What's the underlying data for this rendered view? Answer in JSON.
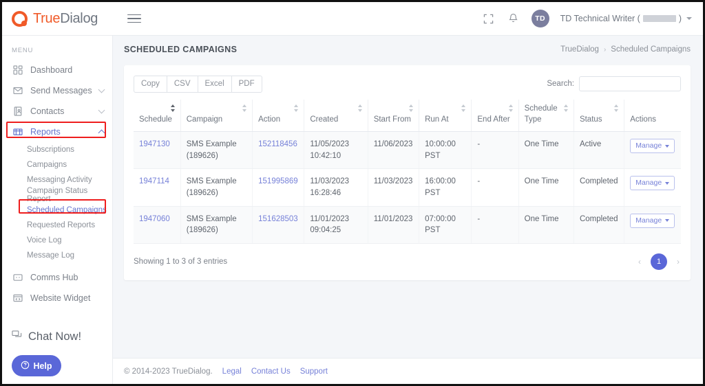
{
  "header": {
    "brand_primary": "True",
    "brand_secondary": "Dialog",
    "menu_toggle": "menu-toggle",
    "fullscreen_label": "Fullscreen",
    "notifications_label": "Notifications",
    "avatar_initials": "TD",
    "username_prefix": "TD Technical Writer (",
    "username_suffix": ")"
  },
  "sidebar": {
    "menu_label": "MENU",
    "items": [
      {
        "label": "Dashboard",
        "icon": "grid-icon",
        "expandable": false,
        "active": false
      },
      {
        "label": "Send Messages",
        "icon": "envelope-icon",
        "expandable": true,
        "active": false
      },
      {
        "label": "Contacts",
        "icon": "address-book-icon",
        "expandable": true,
        "active": false
      },
      {
        "label": "Reports",
        "icon": "reports-icon",
        "expandable": true,
        "active": true
      }
    ],
    "report_subitems": [
      {
        "label": "Subscriptions",
        "active": false
      },
      {
        "label": "Campaigns",
        "active": false
      },
      {
        "label": "Messaging Activity",
        "active": false
      },
      {
        "label": "Campaign Status Report",
        "active": false
      },
      {
        "label": "Scheduled Campaigns",
        "active": true
      },
      {
        "label": "Requested Reports",
        "active": false
      },
      {
        "label": "Voice Log",
        "active": false
      },
      {
        "label": "Message Log",
        "active": false
      }
    ],
    "bottom_items": [
      {
        "label": "Comms Hub",
        "icon": "comms-hub-icon"
      },
      {
        "label": "Website Widget",
        "icon": "website-widget-icon"
      }
    ],
    "chat_now": "Chat Now!",
    "help": "Help"
  },
  "page": {
    "title": "SCHEDULED CAMPAIGNS",
    "breadcrumb": [
      "TrueDialog",
      "Scheduled Campaigns"
    ],
    "breadcrumb_separator": "›"
  },
  "toolbar": {
    "export_buttons": [
      "Copy",
      "CSV",
      "Excel",
      "PDF"
    ],
    "search_label": "Search:",
    "search_value": "",
    "search_placeholder": ""
  },
  "table": {
    "columns": [
      {
        "label": "Schedule",
        "sortable": true,
        "sorted": true
      },
      {
        "label": "Campaign",
        "sortable": true,
        "sorted": false
      },
      {
        "label": "Action",
        "sortable": true,
        "sorted": false
      },
      {
        "label": "Created",
        "sortable": true,
        "sorted": false
      },
      {
        "label": "Start From",
        "sortable": true,
        "sorted": false
      },
      {
        "label": "Run At",
        "sortable": true,
        "sorted": false
      },
      {
        "label": "End After",
        "sortable": true,
        "sorted": false
      },
      {
        "label": "Schedule Type",
        "sortable": true,
        "sorted": false
      },
      {
        "label": "Status",
        "sortable": true,
        "sorted": false
      },
      {
        "label": "Actions",
        "sortable": false,
        "sorted": false
      }
    ],
    "rows": [
      {
        "schedule": "1947130",
        "campaign": "SMS Example (189626)",
        "action": "152118456",
        "created": "11/05/2023 10:42:10",
        "start_from": "11/06/2023",
        "run_at": "10:00:00 PST",
        "end_after": "-",
        "schedule_type": "One Time",
        "status": "Active",
        "actions_label": "Manage"
      },
      {
        "schedule": "1947114",
        "campaign": "SMS Example (189626)",
        "action": "151995869",
        "created": "11/03/2023 16:28:46",
        "start_from": "11/03/2023",
        "run_at": "16:00:00 PST",
        "end_after": "-",
        "schedule_type": "One Time",
        "status": "Completed",
        "actions_label": "Manage"
      },
      {
        "schedule": "1947060",
        "campaign": "SMS Example (189626)",
        "action": "151628503",
        "created": "11/01/2023 09:04:25",
        "start_from": "11/01/2023",
        "run_at": "07:00:00 PST",
        "end_after": "-",
        "schedule_type": "One Time",
        "status": "Completed",
        "actions_label": "Manage"
      }
    ],
    "entries_text": "Showing 1 to 3 of 3 entries",
    "pagination": {
      "prev": "‹",
      "next": "›",
      "pages": [
        "1"
      ],
      "current": "1"
    }
  },
  "footer": {
    "copyright": "© 2014-2023 TrueDialog.",
    "links": [
      "Legal",
      "Contact Us",
      "Support"
    ]
  },
  "colors": {
    "brand_orange": "#f05a28",
    "accent_purple": "#5a67d8",
    "link_purple": "#7681d8",
    "annotation_red": "#ee1d1d",
    "page_bg": "#f4f6f9"
  }
}
